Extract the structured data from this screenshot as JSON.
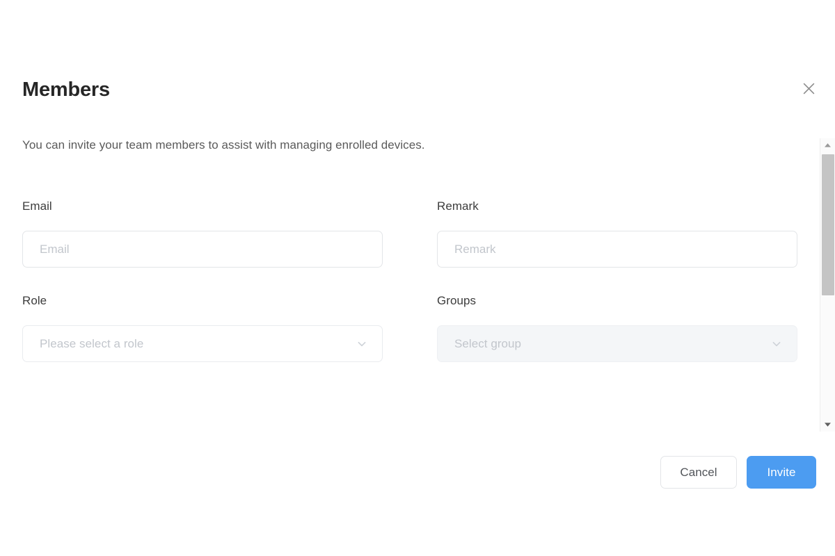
{
  "dialog": {
    "title": "Members",
    "subtitle": "You can invite your team members to assist with managing enrolled devices.",
    "close_icon": "close-icon"
  },
  "form": {
    "fields": [
      {
        "label": "Email",
        "type": "text",
        "placeholder": "Email",
        "value": ""
      },
      {
        "label": "Remark",
        "type": "text",
        "placeholder": "Remark",
        "value": ""
      },
      {
        "label": "Role",
        "type": "select",
        "placeholder": "Please select a role",
        "value": "",
        "disabled": false,
        "arrow_icon": "chevron-down-icon"
      },
      {
        "label": "Groups",
        "type": "select",
        "placeholder": "Select group",
        "value": "",
        "disabled": true,
        "arrow_icon": "chevron-down-icon"
      }
    ]
  },
  "footer": {
    "cancel_label": "Cancel",
    "invite_label": "Invite"
  },
  "scrollbar": {
    "up_icon": "scroll-up-arrow-icon",
    "down_icon": "scroll-down-arrow-icon",
    "position_percent": 0
  },
  "colors": {
    "primary": "#4c9cf1",
    "title": "#262626",
    "body_text": "#5a5a5a",
    "placeholder": "#c2c6cc",
    "border": "#e3e5e8",
    "disabled_bg": "#f4f6f8",
    "scrollbar_thumb": "#c4c4c4"
  }
}
